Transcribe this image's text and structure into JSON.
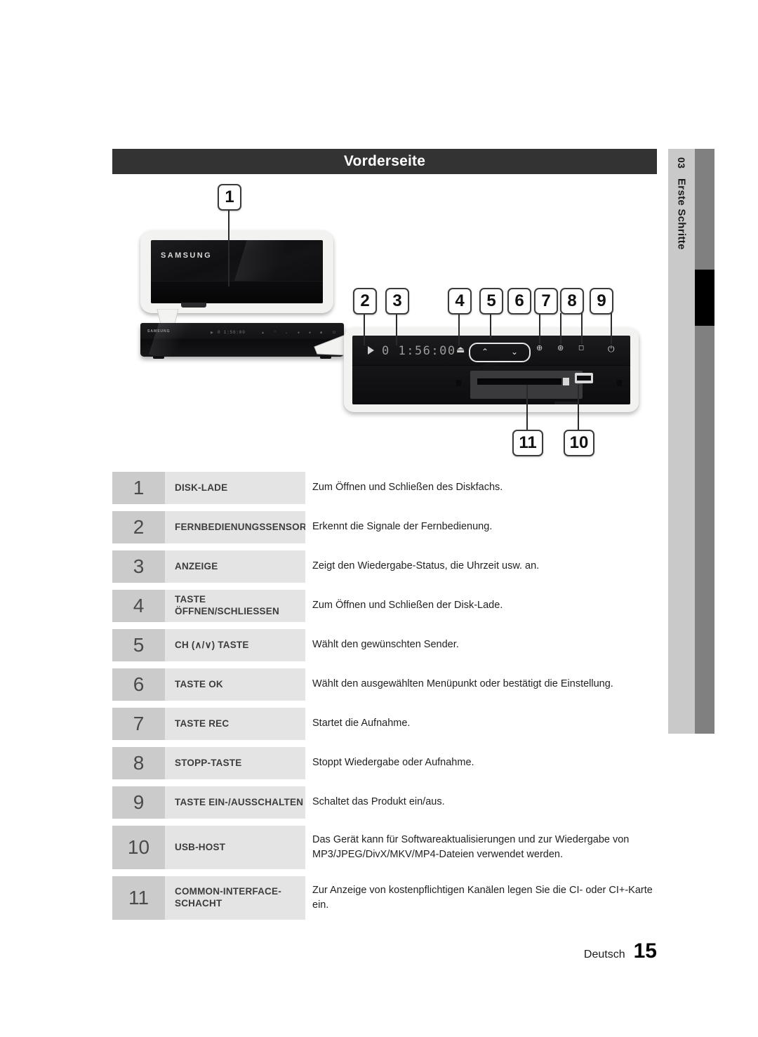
{
  "header": {
    "title": "Vorderseite"
  },
  "side_tab": {
    "chapter_number": "03",
    "chapter_label": "Erste Schritte"
  },
  "diagram": {
    "brand_logo": "SAMSUNG",
    "display_readout": "0 1:56:00",
    "mini_display_readout": "0 1:56:00",
    "icons": {
      "play": "play-triangle-icon",
      "eject": "eject-icon",
      "channel_up": "chevron-up-icon",
      "channel_down": "chevron-down-icon",
      "ok": "ok-button-icon",
      "rec": "record-icon",
      "stop": "stop-square-icon",
      "power": "power-icon",
      "usb": "usb-port-icon",
      "ci_slot": "ci-card-slot-icon"
    },
    "callouts": [
      {
        "id": "1",
        "label": "1"
      },
      {
        "id": "2",
        "label": "2"
      },
      {
        "id": "3",
        "label": "3"
      },
      {
        "id": "4",
        "label": "4"
      },
      {
        "id": "5",
        "label": "5"
      },
      {
        "id": "6",
        "label": "6"
      },
      {
        "id": "7",
        "label": "7"
      },
      {
        "id": "8",
        "label": "8"
      },
      {
        "id": "9",
        "label": "9"
      },
      {
        "id": "10",
        "label": "10"
      },
      {
        "id": "11",
        "label": "11"
      }
    ]
  },
  "table": {
    "rows": [
      {
        "num": "1",
        "label": "DISK-LADE",
        "desc": "Zum Öffnen und Schließen des Diskfachs."
      },
      {
        "num": "2",
        "label": "FERNBEDIENUNGSSENSOR",
        "desc": "Erkennt die Signale der Fernbedienung."
      },
      {
        "num": "3",
        "label": "ANZEIGE",
        "desc": "Zeigt den Wiedergabe-Status, die Uhrzeit usw. an."
      },
      {
        "num": "4",
        "label": "TASTE ÖFFNEN/SCHLIESSEN",
        "desc": "Zum Öffnen und Schließen der Disk-Lade."
      },
      {
        "num": "5",
        "label": "CH (∧/∨) TASTE",
        "desc": "Wählt den gewünschten Sender."
      },
      {
        "num": "6",
        "label": "TASTE OK",
        "desc": "Wählt den ausgewählten Menüpunkt oder bestätigt die Einstellung."
      },
      {
        "num": "7",
        "label": "TASTE REC",
        "desc": "Startet die Aufnahme."
      },
      {
        "num": "8",
        "label": "STOPP-TASTE",
        "desc": "Stoppt Wiedergabe oder Aufnahme."
      },
      {
        "num": "9",
        "label": "TASTE EIN-/AUSSCHALTEN",
        "desc": "Schaltet das Produkt ein/aus."
      },
      {
        "num": "10",
        "label": "USB-HOST",
        "desc": "Das Gerät kann für Softwareaktualisierungen und zur Wiedergabe von MP3/JPEG/DivX/MKV/MP4-Dateien verwendet werden."
      },
      {
        "num": "11",
        "label": "COMMON-INTERFACE-SCHACHT",
        "desc": "Zur Anzeige von kostenpflichtigen Kanälen legen Sie die CI- oder CI+-Karte ein."
      }
    ]
  },
  "footer": {
    "language": "Deutsch",
    "page_number": "15"
  },
  "colors": {
    "header_bar": "#333333",
    "row_num_cell": "#cbcbcb",
    "row_label_cell": "#e4e4e4",
    "side_tab_light": "#c9c9c9",
    "side_tab_dark": "#808080",
    "side_tab_marker": "#000000"
  }
}
